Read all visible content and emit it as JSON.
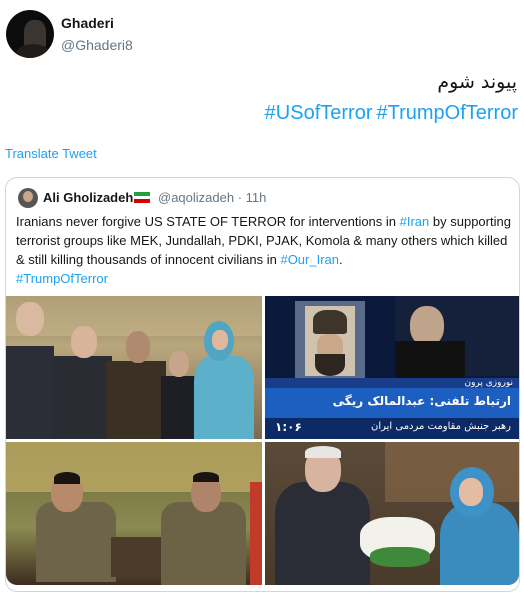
{
  "tweet": {
    "display_name": "Ghaderi",
    "handle": "@Ghaderi8",
    "text_persian": "پیوند شوم",
    "hashtags": [
      "#USofTerror",
      "#TrumpOfTerror"
    ],
    "translate_label": "Translate Tweet"
  },
  "quoted_tweet": {
    "display_name": "Ali Gholizadeh",
    "flag": "iran-flag-icon",
    "handle_time": "@aqolizadeh · 11h",
    "text_before_tag1": "Iranians never forgive US STATE OF TERROR for interventions in ",
    "tag1": "#Iran",
    "text_middle": " by supporting terrorist groups like MEK, Jundallah, PDKI, PJAK, Komola & many others which killed & still killing thousands of innocent civilians in ",
    "tag2": "#Our_Iran",
    "text_after_tag2": ".",
    "tag3": "#TrumpOfTerror"
  },
  "tv_caption": {
    "line1": "نوروزی پرون",
    "line2": "ارتباط تلفنی: عبدالمالک ریگی",
    "line3": "رهبر جنبش مقاومت مردمی ایران",
    "number": "۱:۰۶"
  },
  "colors": {
    "link": "#1da1f2",
    "secondary_text": "#657786",
    "border": "#ccd6dd"
  }
}
